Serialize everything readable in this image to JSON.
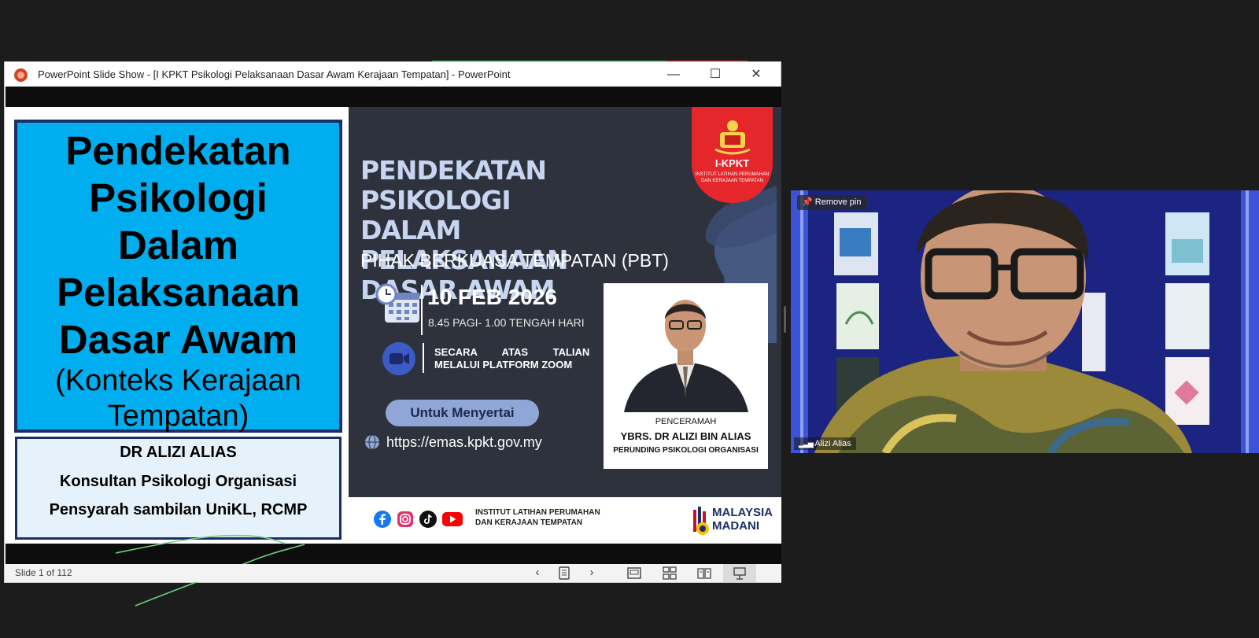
{
  "window": {
    "title": "PowerPoint Slide Show - [I KPKT Psikologi Pelaksanaan Dasar Awam Kerajaan Tempatan] - PowerPoint",
    "minimize": "—",
    "maximize": "☐",
    "close": "✕"
  },
  "slide": {
    "title_lines": [
      "Pendekatan",
      "Psikologi",
      "Dalam",
      "Pelaksanaan",
      "Dasar Awam"
    ],
    "subtitle_lines": [
      "(Konteks Kerajaan",
      "Tempatan)"
    ],
    "author_name": "DR ALIZI ALIAS",
    "author_role": "Konsultan Psikologi Organisasi",
    "author_affiliation": "Pensyarah sambilan UniKL, RCMP"
  },
  "poster": {
    "headline_lines": [
      "PENDEKATAN PSIKOLOGI",
      "DALAM PELAKSANAAN",
      "DASAR AWAM"
    ],
    "subheadline": "PIHAK BERKUASA TEMPATAN (PBT)",
    "badge_title": "I-KPKT",
    "badge_caption_lines": [
      "INSTITUT LATIHAN PERUMAHAN",
      "DAN KERAJAAN TEMPATAN"
    ],
    "date": "10 FEB 2026",
    "time": "8.45 PAGI- 1.00 TENGAH HARI",
    "online_line1": "SECARA ATAS TALIAN",
    "online_line2": "MELALUI PLATFORM ZOOM",
    "register_button": "Untuk Menyertai",
    "url": "https://emas.kpkt.gov.my",
    "speaker_role": "PENCERAMAH",
    "speaker_name": "YBRS. DR ALIZI BIN ALIAS",
    "speaker_title": "PERUNDING PSIKOLOGI ORGANISASI",
    "footer_org_lines": [
      "INSTITUT LATIHAN PERUMAHAN",
      "DAN KERAJAAN TEMPATAN"
    ],
    "footer_logo_lines": [
      "MALAYSIA",
      "MADANI"
    ]
  },
  "statusbar": {
    "slide_counter": "Slide 1 of 112"
  },
  "video": {
    "pin_label": "Remove pin",
    "participant_name": "Alizi Alias"
  },
  "colors": {
    "title_box": "#00aeef",
    "poster_bg": "#2d323d",
    "badge_red": "#e5262a",
    "tile_bg": "#1b2480"
  }
}
